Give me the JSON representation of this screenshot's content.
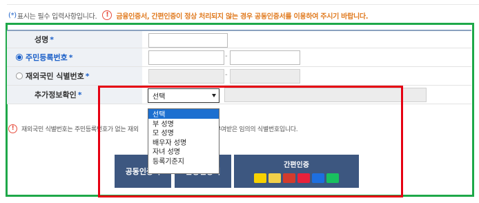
{
  "notice": {
    "asterisk": "(*)",
    "required_text": "표시는 필수 입력사항입니다.",
    "warn_glyph": "!",
    "warning": "금융인증서, 간편인증이 정상 처리되지 않는 경우 공동인증서를 이용하여 주시기 바랍니다."
  },
  "form": {
    "name_label": "성명",
    "rrn_label": "주민등록번호",
    "foreign_label": "재외국민 식별번호",
    "extra_label": "추가정보확인",
    "star": "*",
    "dash": "-"
  },
  "select": {
    "value": "선택",
    "options": [
      "선택",
      "부 성명",
      "모 성명",
      "배우자 성명",
      "자녀 성명",
      "등록기준지"
    ]
  },
  "info": {
    "glyph": "!",
    "text_left": "재외국민 식별번호는 주민등록번호가 없는 재외",
    "text_right": "을 때 부여받은 임의의 식별번호입니다."
  },
  "buttons": {
    "cert": "공동인증서",
    "financial": "금융인증서",
    "simple": "간편인증"
  },
  "auth_logos": [
    {
      "label": "카카오",
      "bg": "#f7d100",
      "fg": "#3a1d1d"
    },
    {
      "label": "페이코",
      "bg": "#f2d04a",
      "fg": "#222"
    },
    {
      "label": "KB",
      "bg": "#d33b2c",
      "fg": "#ffffff"
    },
    {
      "label": "PASS",
      "bg": "#e8213b",
      "fg": "#ffffff"
    },
    {
      "label": "Pass",
      "bg": "#1d6fe0",
      "fg": "#ffffff"
    },
    {
      "label": "N",
      "bg": "#19c15f",
      "fg": "#ffffff"
    }
  ],
  "colors": {
    "green_box": "#1ea849",
    "red_box": "#e60012",
    "button_bg": "#3d5780",
    "accent_blue": "#1a5fc8",
    "warning_orange": "#e07a1f"
  }
}
